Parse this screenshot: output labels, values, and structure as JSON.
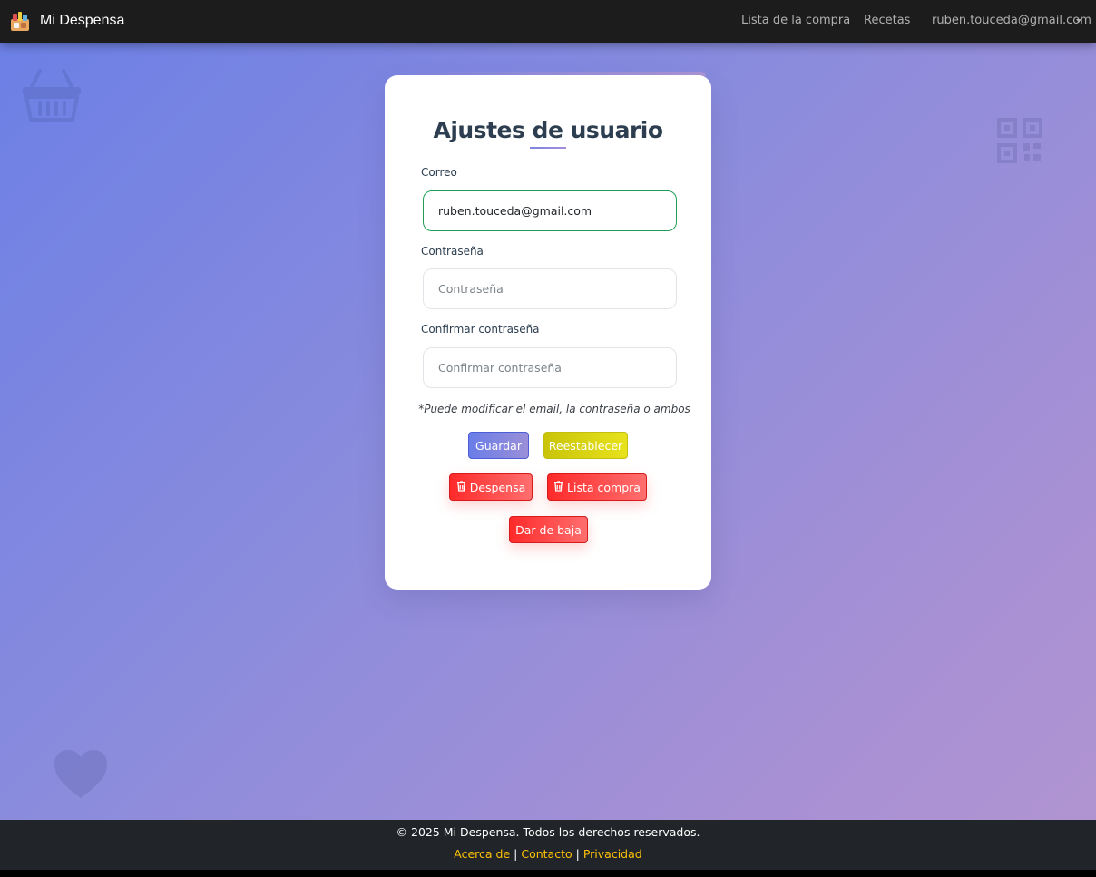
{
  "navbar": {
    "brand": "Mi Despensa",
    "logo_icon": "pantry-logo-icon",
    "links": [
      "Lista de la compra",
      "Recetas"
    ],
    "user_email": "ruben.touceda@gmail.com"
  },
  "card": {
    "title": "Ajustes de usuario",
    "email_label": "Correo",
    "email_value": "ruben.touceda@gmail.com",
    "password_label": "Contraseña",
    "password_placeholder": "Contraseña",
    "confirm_label": "Confirmar contraseña",
    "confirm_placeholder": "Confirmar contraseña",
    "note": "*Puede modificar el email, la contraseña o ambos",
    "buttons": {
      "save": "Guardar",
      "reset": "Reestablecer",
      "delete_pantry": "Despensa",
      "delete_list": "Lista compra",
      "unsubscribe": "Dar de baja"
    }
  },
  "footer": {
    "copyright": "© 2025 Mi Despensa. Todos los derechos reservados.",
    "links": [
      "Acerca de",
      "Contacto",
      "Privacidad"
    ],
    "separator": "|"
  },
  "colors": {
    "primary": "#6a7de8",
    "warning": "#d4cf0e",
    "danger": "#ff3b3b",
    "footer_link": "#ffc107",
    "navbar_bg": "#1c1c1c",
    "footer_bg": "#212529"
  },
  "decorative_icons": [
    "basket-icon",
    "qr-code-icon",
    "heart-icon"
  ]
}
